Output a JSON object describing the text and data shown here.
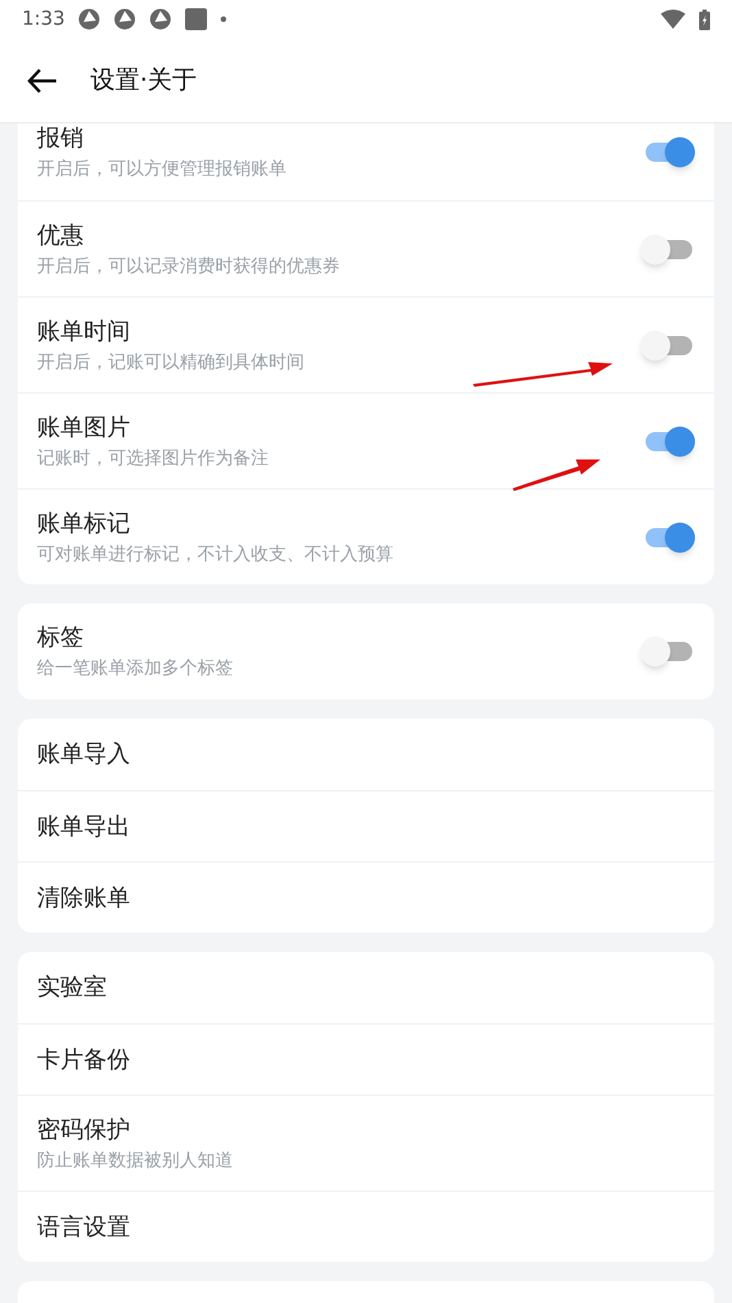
{
  "status_bar": {
    "time": "1:33"
  },
  "header": {
    "title": "设置·关于"
  },
  "groups": [
    {
      "items": [
        {
          "kind": "toggle",
          "title": "报销",
          "subtitle": "开启后，可以方便管理报销账单",
          "on": true
        },
        {
          "kind": "toggle",
          "title": "优惠",
          "subtitle": "开启后，可以记录消费时获得的优惠券",
          "on": false
        },
        {
          "kind": "toggle",
          "title": "账单时间",
          "subtitle": "开启后，记账可以精确到具体时间",
          "on": false
        },
        {
          "kind": "toggle",
          "title": "账单图片",
          "subtitle": "记账时，可选择图片作为备注",
          "on": true
        },
        {
          "kind": "toggle",
          "title": "账单标记",
          "subtitle": "可对账单进行标记，不计入收支、不计入预算",
          "on": true
        }
      ]
    },
    {
      "items": [
        {
          "kind": "toggle",
          "title": "标签",
          "subtitle": "给一笔账单添加多个标签",
          "on": false
        }
      ]
    },
    {
      "items": [
        {
          "kind": "link",
          "title": "账单导入"
        },
        {
          "kind": "link",
          "title": "账单导出"
        },
        {
          "kind": "link",
          "title": "清除账单"
        }
      ]
    },
    {
      "items": [
        {
          "kind": "link",
          "title": "实验室"
        },
        {
          "kind": "link",
          "title": "卡片备份"
        },
        {
          "kind": "link",
          "title": "密码保护",
          "subtitle": "防止账单数据被别人知道"
        },
        {
          "kind": "link",
          "title": "语言设置"
        }
      ]
    }
  ]
}
